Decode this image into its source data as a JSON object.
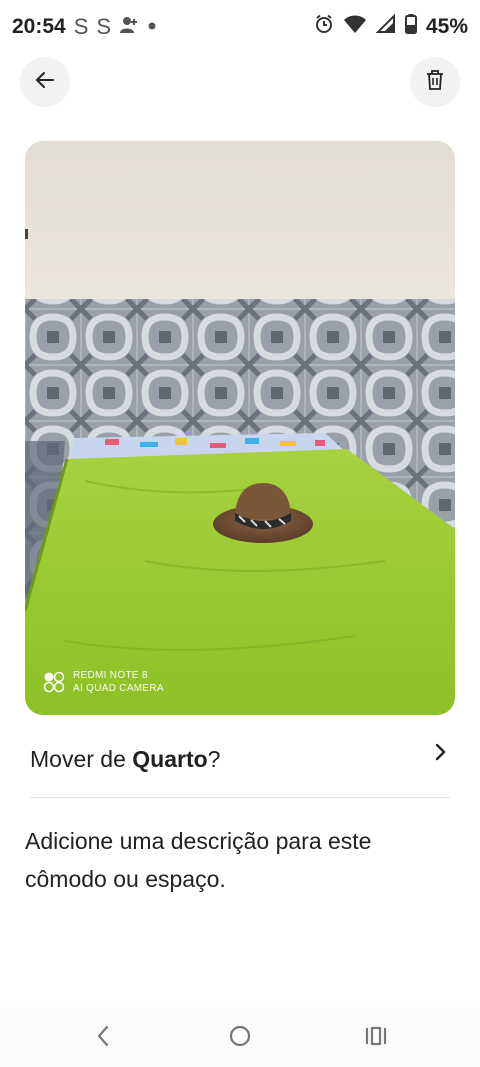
{
  "status_bar": {
    "time": "20:54",
    "s1": "S",
    "s2": "S",
    "battery": "45%",
    "icons": [
      "person-add-icon",
      "dot-icon",
      "alarm-icon",
      "wifi-icon",
      "signal-icon",
      "battery-icon"
    ]
  },
  "header": {
    "back_icon": "arrow-left-icon",
    "delete_icon": "trash-icon"
  },
  "photo": {
    "watermark_line1": "REDMI NOTE 8",
    "watermark_line2": "AI QUAD CAMERA"
  },
  "move": {
    "prefix": "Mover de ",
    "room": "Quarto",
    "suffix": "?",
    "icon": "chevron-right-icon"
  },
  "description": {
    "title": "Adicione uma descrição para este cômodo ou espaço."
  },
  "nav": {
    "icons": [
      "nav-back-icon",
      "nav-home-icon",
      "nav-recents-icon"
    ]
  }
}
